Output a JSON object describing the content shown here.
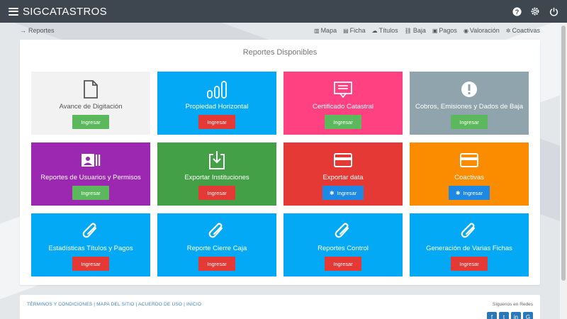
{
  "app": {
    "brand": "SIGCATASTROS",
    "icons": [
      "help-icon",
      "settings-icon",
      "power-icon"
    ]
  },
  "breadcrumb": {
    "label": "Reportes"
  },
  "nav": [
    {
      "label": "Mapa",
      "icon": "map-icon"
    },
    {
      "label": "Ficha",
      "icon": "file-icon"
    },
    {
      "label": "Títulos",
      "icon": "cloud-icon"
    },
    {
      "label": "Baja",
      "icon": "link-icon"
    },
    {
      "label": "Pagos",
      "icon": "wallet-icon"
    },
    {
      "label": "Valoración",
      "icon": "coin-icon"
    },
    {
      "label": "Coactivas",
      "icon": "bug-icon"
    }
  ],
  "panel": {
    "title": "Reportes Disponibles",
    "tiles": [
      {
        "label": "Avance de Digitación",
        "button": "Ingresar",
        "bg": "#f2f2f2",
        "btn_bg": "#5cb85c",
        "icon": "document-icon",
        "light": true
      },
      {
        "label": "Propiedad Horizontal",
        "button": "Ingresar",
        "bg": "#03a9f4",
        "btn_bg": "#e53935",
        "icon": "bar-chart-icon"
      },
      {
        "label": "Certificado Catastral",
        "button": "Ingresar",
        "bg": "#ff4081",
        "btn_bg": "#5cb85c",
        "icon": "certificate-icon"
      },
      {
        "label": "Cobros, Emisiones y Dados de Baja",
        "button": "Ingresar",
        "bg": "#90a4ae",
        "btn_bg": "#5cb85c",
        "icon": "alert-icon"
      },
      {
        "label": "Reportes de Usuarios y Permisos",
        "button": "Ingresar",
        "bg": "#9c27b0",
        "btn_bg": "#5cb85c",
        "icon": "id-card-icon"
      },
      {
        "label": "Exportar Instituciones",
        "button": "Ingresar",
        "bg": "#43a047",
        "btn_bg": "#e53935",
        "icon": "download-icon"
      },
      {
        "label": "Exportar data",
        "button": "Ingresar",
        "bg": "#e53935",
        "btn_bg": "#1e88e5",
        "icon": "card-icon",
        "btn_icon": true
      },
      {
        "label": "Coactivas",
        "button": "Ingresar",
        "bg": "#fb8c00",
        "btn_bg": "#1e88e5",
        "icon": "card-icon",
        "btn_icon": true
      },
      {
        "label": "Estadísticas Títulos y Pagos",
        "button": "Ingresar",
        "bg": "#03a9f4",
        "btn_bg": "#e53935",
        "icon": "paperclip-icon"
      },
      {
        "label": "Reporte Cierre Caja",
        "button": "Ingresar",
        "bg": "#03a9f4",
        "btn_bg": "#e53935",
        "icon": "paperclip-icon"
      },
      {
        "label": "Reportes Control",
        "button": "Ingresar",
        "bg": "#03a9f4",
        "btn_bg": "#e53935",
        "icon": "paperclip-icon"
      },
      {
        "label": "Generación de Varias Fichas",
        "button": "Ingresar",
        "bg": "#03a9f4",
        "btn_bg": "#e53935",
        "icon": "paperclip-icon"
      }
    ]
  },
  "footer": {
    "links": "TÉRMINOS Y CONDICIONES | MAPA DEL SITIO | ACUERDO DE USO | INICIO",
    "social_label": "Síguenos en Redes",
    "social": [
      {
        "name": "facebook-icon",
        "glyph": "f"
      },
      {
        "name": "twitter-icon",
        "glyph": "t"
      },
      {
        "name": "linkedin-icon",
        "glyph": "in"
      },
      {
        "name": "googleplus-icon",
        "glyph": "G"
      }
    ]
  }
}
